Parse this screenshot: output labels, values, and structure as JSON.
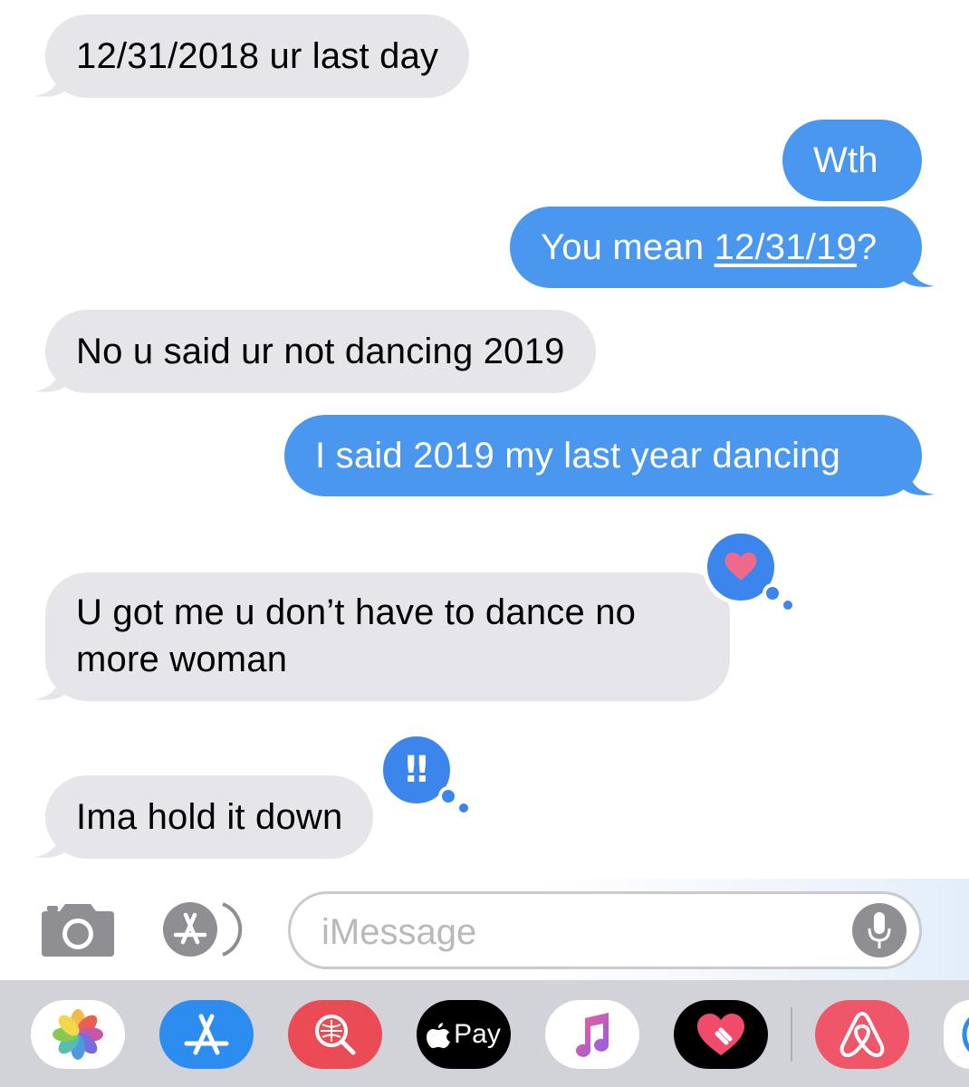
{
  "messages": [
    {
      "id": "m1",
      "side": "in",
      "text": "12/31/2018 ur last day"
    },
    {
      "id": "m2",
      "side": "out",
      "text": "Wth"
    },
    {
      "id": "m3",
      "side": "out",
      "prefix": "You mean ",
      "link": "12/31/19",
      "suffix": "?"
    },
    {
      "id": "m4",
      "side": "in",
      "text": "No u said ur not dancing 2019"
    },
    {
      "id": "m5",
      "side": "out",
      "text": "I said 2019 my last year dancing"
    },
    {
      "id": "m6",
      "side": "in",
      "text": "U got me u don’t have to dance no more woman",
      "tapback": "heart"
    },
    {
      "id": "m7",
      "side": "in",
      "text": "Ima hold it down",
      "tapback": "exclamation"
    }
  ],
  "tapbacks": {
    "heart": {
      "icon": "heart-icon",
      "color": "#ee6a8c"
    },
    "exclamation": {
      "icon": "double-exclamation-icon",
      "symbol": "‼"
    }
  },
  "input_bar": {
    "placeholder": "iMessage",
    "camera_icon": "camera-icon",
    "apps_icon": "app-store-icon",
    "mic_icon": "microphone-icon"
  },
  "app_drawer": {
    "apps": [
      {
        "name": "photos-icon"
      },
      {
        "name": "app-store-icon"
      },
      {
        "name": "search-images-icon"
      },
      {
        "name": "apple-pay-icon",
        "label": "Pay"
      },
      {
        "name": "music-icon"
      },
      {
        "name": "digital-touch-icon"
      },
      {
        "name": "airbnb-icon"
      },
      {
        "name": "more-app-icon"
      }
    ]
  },
  "colors": {
    "incoming": "#e5e5ea",
    "outgoing": "#4a97f0",
    "tapback": "#3c85ec",
    "drawer": "#d1d3d9"
  }
}
